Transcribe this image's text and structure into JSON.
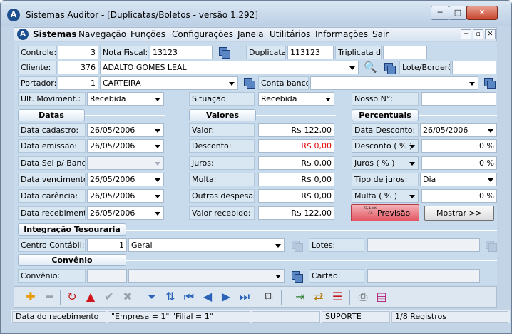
{
  "window": {
    "title": "Sistemas Auditor - [Duplicatas/Boletos - versão 1.292]",
    "min": "─",
    "max": "□",
    "close": "✕"
  },
  "menu": {
    "items": [
      "Sistemas",
      "Navegação",
      "Funções",
      "Configurações",
      "Janela",
      "Utilitários",
      "Informações",
      "Sair"
    ],
    "mdi": [
      "─",
      "▫",
      "✕"
    ]
  },
  "fields": {
    "controle": {
      "label": "Controle:",
      "value": "3"
    },
    "nota_fiscal": {
      "label": "Nota Fiscal:",
      "value": "13123"
    },
    "duplicata": {
      "label": "Duplicata:",
      "value": "113123"
    },
    "triplicata": {
      "label": "Triplicata de:",
      "value": ""
    },
    "cliente": {
      "label": "Cliente:",
      "code": "376",
      "name": "ADALTO GOMES LEAL"
    },
    "lote": {
      "label": "Lote/Borderô:",
      "value": ""
    },
    "portador": {
      "label": "Portador:",
      "code": "1",
      "name": "CARTEIRA"
    },
    "conta_banco": {
      "label": "Conta banco:",
      "value": ""
    },
    "ult_moviment": {
      "label": "Ult. Moviment.:",
      "value": "Recebida"
    },
    "situacao": {
      "label": "Situação:",
      "value": "Recebida"
    },
    "nosso_no": {
      "label": "Nosso N°:",
      "value": ""
    }
  },
  "sections": {
    "datas": "Datas",
    "valores": "Valores",
    "percentuais": "Percentuais",
    "integracao": "Integração Tesouraria",
    "convenio": "Convênio"
  },
  "datas": [
    {
      "label": "Data cadastro:",
      "value": "26/05/2006"
    },
    {
      "label": "Data emissão:",
      "value": "26/05/2006"
    },
    {
      "label": "Data Sel p/ Banco:",
      "value": ""
    },
    {
      "label": "Data vencimento:",
      "value": "26/05/2006"
    },
    {
      "label": "Data carência:",
      "value": "26/05/2006"
    },
    {
      "label": "Data recebimento:",
      "value": "26/05/2006"
    }
  ],
  "valores": [
    {
      "label": "Valor:",
      "value": "R$ 122,00"
    },
    {
      "label": "Desconto:",
      "value": "R$ 0,00"
    },
    {
      "label": "Juros:",
      "value": "R$ 0,00"
    },
    {
      "label": "Multa:",
      "value": "R$ 0,00"
    },
    {
      "label": "Outras despesas:",
      "value": "R$ 0,00"
    },
    {
      "label": "Valor recebido:",
      "value": "R$ 122,00"
    }
  ],
  "percentuais": [
    {
      "label": "Data Desconto:",
      "value": "26/05/2006"
    },
    {
      "label": "Desconto ( % )",
      "value": "0 %"
    },
    {
      "label": "Juros ( % )",
      "value": "0 %"
    },
    {
      "label": "Tipo de juros:",
      "value": "Dia"
    },
    {
      "label": "Multa ( % )",
      "value": "0 %"
    }
  ],
  "buttons": {
    "previsao": "Previsão",
    "previsao_badge": "0,15x 7x",
    "mostrar": "Mostrar >>"
  },
  "integracao": {
    "centro_label": "Centro Contábil:",
    "centro_code": "1",
    "centro_name": "Geral",
    "lotes_label": "Lotes:",
    "lotes_value": ""
  },
  "convenio": {
    "label": "Convênio:",
    "code": "",
    "name": "",
    "cartao_label": "Cartão:",
    "cartao_value": ""
  },
  "status": {
    "field": "Data do recebimento",
    "empresa": "\"Empresa = 1\"   \"Filial = 1\"",
    "empty": "",
    "user": "SUPORTE",
    "records": "1/8 Registros"
  },
  "colors": {
    "accent": "#1e4f8f",
    "form_bg": "#c8dbec",
    "danger": "#e00000"
  }
}
